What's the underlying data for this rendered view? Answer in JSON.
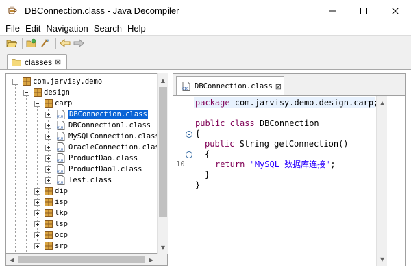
{
  "window": {
    "title": "DBConnection.class - Java Decompiler",
    "minimize_icon": "minimize-icon",
    "maximize_icon": "maximize-icon",
    "close_icon": "close-icon"
  },
  "menu": [
    "File",
    "Edit",
    "Navigation",
    "Search",
    "Help"
  ],
  "toolbar": {
    "icons": [
      "open-file-icon",
      "open-type-icon",
      "search-icon",
      "back-icon",
      "forward-icon"
    ]
  },
  "outer_tab": {
    "label": "classes",
    "close": "⊠"
  },
  "tree": {
    "root": "com.jarvisy.demo",
    "design": "design",
    "carp": "carp",
    "classes": [
      "DBConnection.class",
      "DBConnection1.class",
      "MySQLConnection.class",
      "OracleConnection.class",
      "ProductDao.class",
      "ProductDao1.class",
      "Test.class"
    ],
    "packages": [
      "dip",
      "isp",
      "lkp",
      "lsp",
      "ocp",
      "srp"
    ],
    "selected": "DBConnection.class"
  },
  "editor": {
    "tab_label": "DBConnection.class",
    "tab_close": "⊠",
    "line_number": "10",
    "code": {
      "l1_kw": "package",
      "l1_rest": " com.jarvisy.demo.design.carp;",
      "l3_kw1": "public",
      "l3_kw2": "class",
      "l3_rest": " DBConnection",
      "l4": "{",
      "l5_kw": "public",
      "l5_rest": " String getConnection()",
      "l6": "{",
      "l7_kw": "return",
      "l7_str": "\"MySQL 数据库连接\"",
      "l7_end": ";",
      "l8": "}",
      "l9": "}"
    }
  },
  "colors": {
    "keyword": "#7f0055",
    "string": "#2a00ff",
    "selection": "#0a64d6",
    "current_line": "#e8f2fe",
    "package_icon": "#c28a2e"
  }
}
